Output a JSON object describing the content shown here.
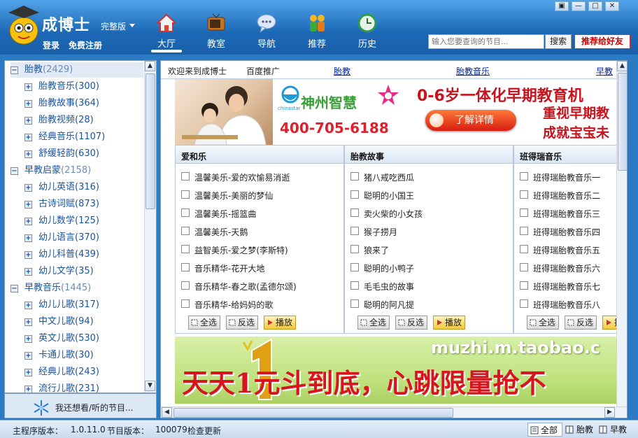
{
  "app": {
    "title": "成博士",
    "edition": "完整版",
    "login": "登录",
    "register": "免费注册"
  },
  "window_controls": [
    "▣",
    "—",
    "□",
    "✕"
  ],
  "nav": [
    {
      "label": "大厅",
      "icon": "home-icon"
    },
    {
      "label": "教室",
      "icon": "tv-icon"
    },
    {
      "label": "导航",
      "icon": "chat-bubble-icon"
    },
    {
      "label": "推荐",
      "icon": "people-icon"
    },
    {
      "label": "历史",
      "icon": "history-icon"
    }
  ],
  "search": {
    "placeholder": "输入您要查询的节目...",
    "button": "搜索"
  },
  "recommend_button": "推荐给好友",
  "sidebar": {
    "items": [
      {
        "label": "胎教",
        "count": "(2429)",
        "type": "category"
      },
      {
        "label": "胎教音乐",
        "count": "(300)",
        "type": "child"
      },
      {
        "label": "胎教故事",
        "count": "(364)",
        "type": "child"
      },
      {
        "label": "胎教视频",
        "count": "(28)",
        "type": "child"
      },
      {
        "label": "经典音乐",
        "count": "(1107)",
        "type": "child"
      },
      {
        "label": "舒缓轻韵",
        "count": "(630)",
        "type": "child"
      },
      {
        "label": "早教启蒙",
        "count": "(2158)",
        "type": "category"
      },
      {
        "label": "幼儿英语",
        "count": "(316)",
        "type": "child"
      },
      {
        "label": "古诗词赋",
        "count": "(873)",
        "type": "child"
      },
      {
        "label": "幼儿数学",
        "count": "(125)",
        "type": "child"
      },
      {
        "label": "幼儿语言",
        "count": "(370)",
        "type": "child"
      },
      {
        "label": "幼儿科普",
        "count": "(439)",
        "type": "child"
      },
      {
        "label": "幼儿文学",
        "count": "(35)",
        "type": "child"
      },
      {
        "label": "早教音乐",
        "count": "(1445)",
        "type": "category"
      },
      {
        "label": "幼儿儿歌",
        "count": "(317)",
        "type": "child"
      },
      {
        "label": "中文儿歌",
        "count": "(94)",
        "type": "child"
      },
      {
        "label": "英文儿歌",
        "count": "(530)",
        "type": "child"
      },
      {
        "label": "卡通儿歌",
        "count": "(30)",
        "type": "child"
      },
      {
        "label": "经典儿歌",
        "count": "(243)",
        "type": "child"
      },
      {
        "label": "流行儿歌",
        "count": "(231)",
        "type": "child"
      }
    ],
    "wish_label": "我还想看/听的节目..."
  },
  "main": {
    "top_tabs": [
      {
        "label": "欢迎来到成博士",
        "link": false
      },
      {
        "label": "百度推广",
        "link": false
      },
      {
        "label": "胎教",
        "link": true
      },
      {
        "label": "胎教音乐",
        "link": true
      },
      {
        "label": "早教",
        "link": true
      }
    ],
    "banner": {
      "headline": "0-6岁一体化早期教育机",
      "sub1": "重视早期教",
      "sub2": "成就宝宝未",
      "brand": "神州智慧",
      "brand_en": "chinastar",
      "phone": "400-705-6188",
      "button": "了解详情"
    },
    "columns": [
      {
        "title": "爱和乐",
        "items": [
          "温馨美乐-爱的欢愉易消逝",
          "温馨美乐-美丽的梦仙",
          "温馨美乐-摇篮曲",
          "温馨美乐-天鹅",
          "益智美乐-爱之梦(李斯特)",
          "音乐精华-花开大地",
          "音乐精华-春之歌(孟德尔颂)",
          "音乐精华-给妈妈的歌"
        ]
      },
      {
        "title": "胎教故事",
        "items": [
          "猪八戒吃西瓜",
          "聪明的小国王",
          "卖火柴的小女孩",
          "猴子捞月",
          "狼来了",
          "聪明的小鸭子",
          "毛毛虫的故事",
          "聪明的阿凡提"
        ]
      },
      {
        "title": "班得瑞音乐",
        "items": [
          "班得瑞胎教音乐一",
          "班得瑞胎教音乐二",
          "班得瑞胎教音乐三",
          "班得瑞胎教音乐四",
          "班得瑞胎教音乐五",
          "班得瑞胎教音乐六",
          "班得瑞胎教音乐七",
          "班得瑞胎教音乐八"
        ]
      }
    ],
    "actions": {
      "select_all": "全选",
      "invert": "反选",
      "play": "播放"
    },
    "ad": {
      "url": "muzhi.m.taobao.c",
      "slogan": "天天1元斗到底，心跳限量抢不"
    }
  },
  "status": {
    "program_version_label": "主程序版本：",
    "program_version": "1.0.11.0",
    "content_version_label": "节目版本：",
    "content_version": "100079",
    "check_update": "检查更新",
    "filters": [
      "全部",
      "胎教",
      "早教"
    ]
  },
  "colors": {
    "accent": "#1a5fa8",
    "link": "#00249c",
    "highlight": "#d8141e"
  }
}
